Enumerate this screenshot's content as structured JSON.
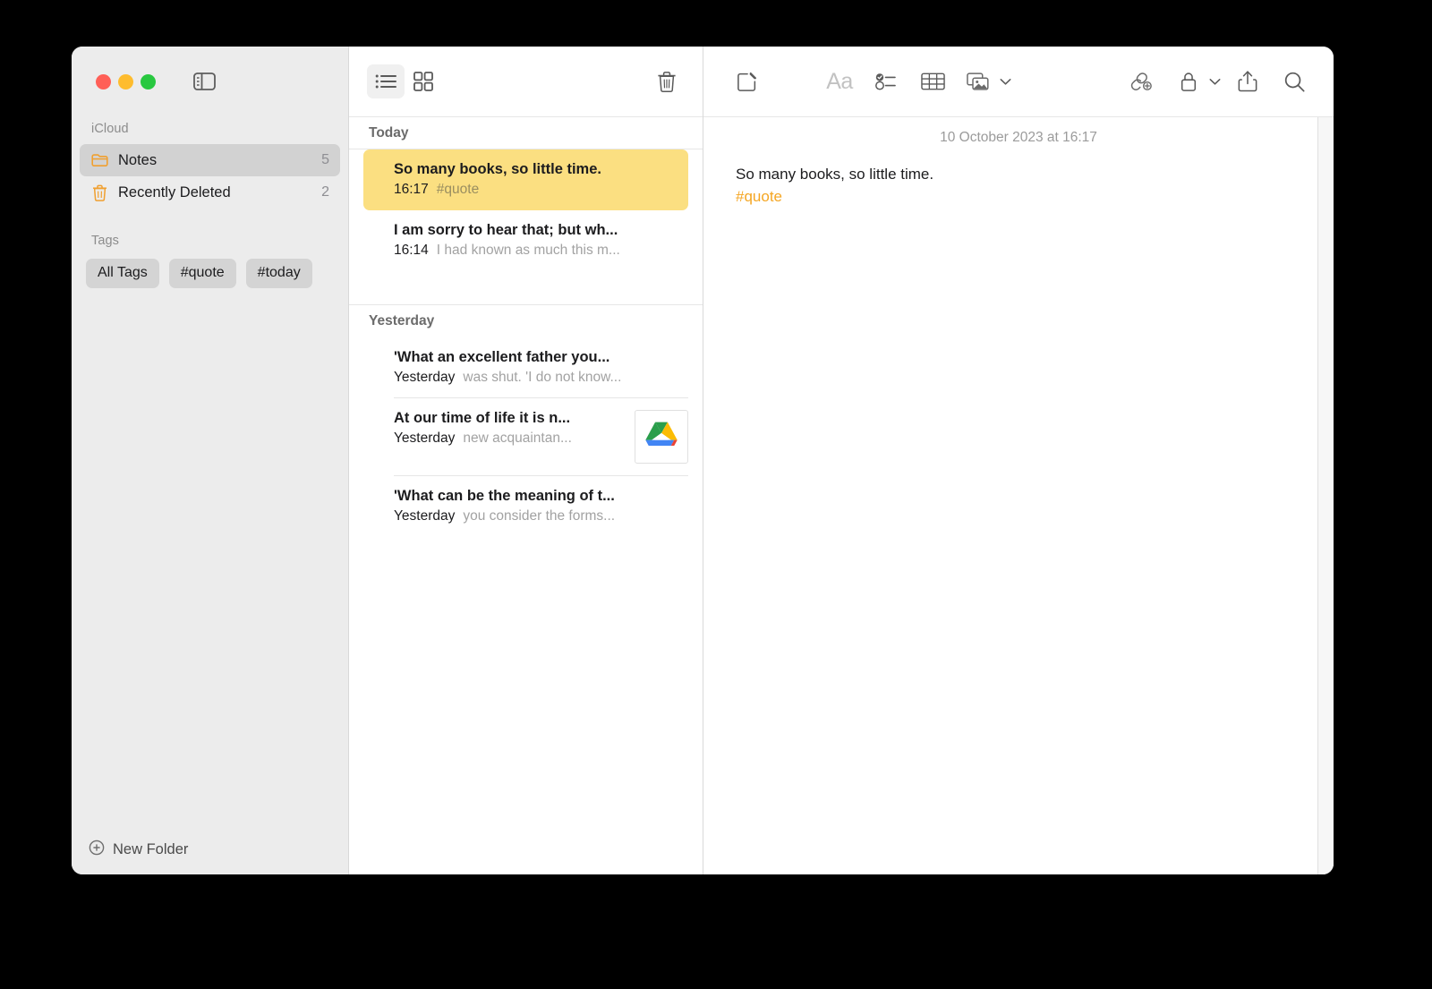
{
  "window": {
    "traffic_lights": [
      "close",
      "minimize",
      "zoom"
    ],
    "sidebar_toggle_icon": "sidebar-toggle-icon"
  },
  "sidebar": {
    "icloud_label": "iCloud",
    "folders": [
      {
        "icon": "folder-icon",
        "name": "Notes",
        "count": "5",
        "selected": true
      },
      {
        "icon": "trash-icon",
        "name": "Recently Deleted",
        "count": "2",
        "selected": false
      }
    ],
    "tags_label": "Tags",
    "tags": [
      "All Tags",
      "#quote",
      "#today"
    ],
    "new_folder_label": "New Folder",
    "new_folder_icon": "plus-circle-icon"
  },
  "list_toolbar": {
    "list_view_icon": "list-view-icon",
    "gallery_view_icon": "gallery-view-icon",
    "delete_icon": "trash-icon"
  },
  "note_list": {
    "groups": [
      {
        "header": "Today",
        "notes": [
          {
            "title": "So many books, so little time.",
            "date": "16:17",
            "snippet": "#quote",
            "selected": true,
            "thumbnail": null
          },
          {
            "title": "I am sorry to hear that; but wh...",
            "date": "16:14",
            "snippet": "I had known as much this m...",
            "selected": false,
            "thumbnail": null
          }
        ]
      },
      {
        "header": "Yesterday",
        "notes": [
          {
            "title": "'What an excellent father you...",
            "date": "Yesterday",
            "snippet": "was shut. 'I do not know...",
            "selected": false,
            "thumbnail": null
          },
          {
            "title": "At our time of life it is n...",
            "date": "Yesterday",
            "snippet": "new acquaintan...",
            "selected": false,
            "thumbnail": "google-drive-icon"
          },
          {
            "title": "'What can be the meaning of t...",
            "date": "Yesterday",
            "snippet": "you consider the forms...",
            "selected": false,
            "thumbnail": null
          }
        ]
      }
    ]
  },
  "editor_toolbar": {
    "compose_icon": "compose-note-icon",
    "format_label": "Aa",
    "checklist_icon": "checklist-icon",
    "table_icon": "table-icon",
    "media_icon": "media-icon",
    "media_chevron_icon": "chevron-down-icon",
    "link_icon": "add-link-icon",
    "lock_icon": "lock-icon",
    "lock_chevron_icon": "chevron-down-icon",
    "share_icon": "share-icon",
    "search_icon": "search-icon"
  },
  "editor": {
    "timestamp": "10 October 2023 at 16:17",
    "body_text": "So many books, so little time.",
    "tag": "#quote"
  },
  "colors": {
    "selected_note": "#fbdf81",
    "accent_orange": "#f5a623",
    "folder_orange": "#f0a030",
    "sidebar_bg": "#ececec"
  }
}
